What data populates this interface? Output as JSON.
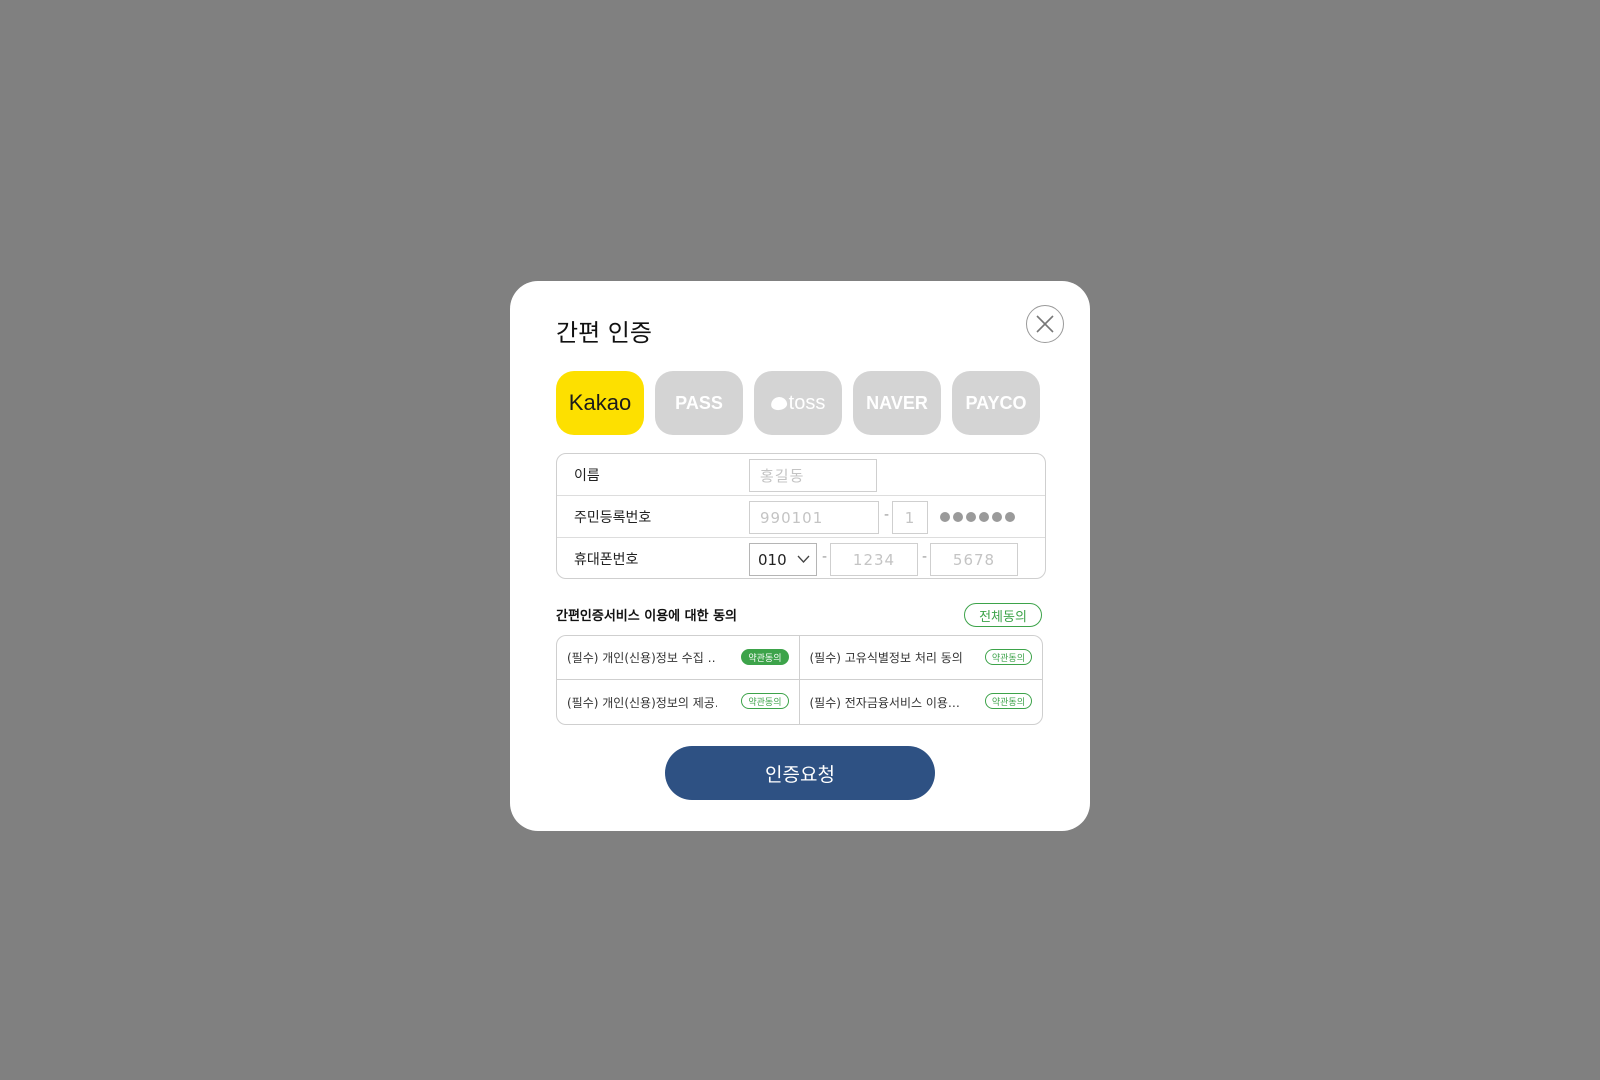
{
  "dialog": {
    "title": "간편 인증",
    "close_icon": "close-icon"
  },
  "providers": [
    {
      "label": "Kakao",
      "active": true
    },
    {
      "label": "PASS",
      "active": false
    },
    {
      "label": "toss",
      "active": false
    },
    {
      "label": "NAVER",
      "active": false
    },
    {
      "label": "PAYCO",
      "active": false
    }
  ],
  "form": {
    "name": {
      "label": "이름",
      "placeholder": "홍길동"
    },
    "rrn": {
      "label": "주민등록번호",
      "front_placeholder": "990101",
      "dash": "-",
      "back_first_placeholder": "1"
    },
    "phone": {
      "label": "휴대폰번호",
      "prefix_selected": "010",
      "dash": "-",
      "middle_placeholder": "1234",
      "last_placeholder": "5678"
    }
  },
  "agreement": {
    "title": "간편인증서비스 이용에 대한 동의",
    "all_label": "전체동의",
    "terms": [
      {
        "text": "(필수) 개인(신용)정보 수집 …",
        "badge": "약관동의",
        "checked": true
      },
      {
        "text": "(필수) 고유식별정보 처리 동의",
        "badge": "약관동의",
        "checked": false
      },
      {
        "text": "(필수) 개인(신용)정보의 제공…",
        "badge": "약관동의",
        "checked": false
      },
      {
        "text": "(필수) 전자금융서비스 이용…",
        "badge": "약관동의",
        "checked": false
      }
    ]
  },
  "submit_label": "인증요청",
  "colors": {
    "backdrop": "#808080",
    "kakao": "#fde000",
    "inactive_provider": "#d4d4d4",
    "accent_green": "#3da34a",
    "submit_blue": "#2e5183"
  }
}
